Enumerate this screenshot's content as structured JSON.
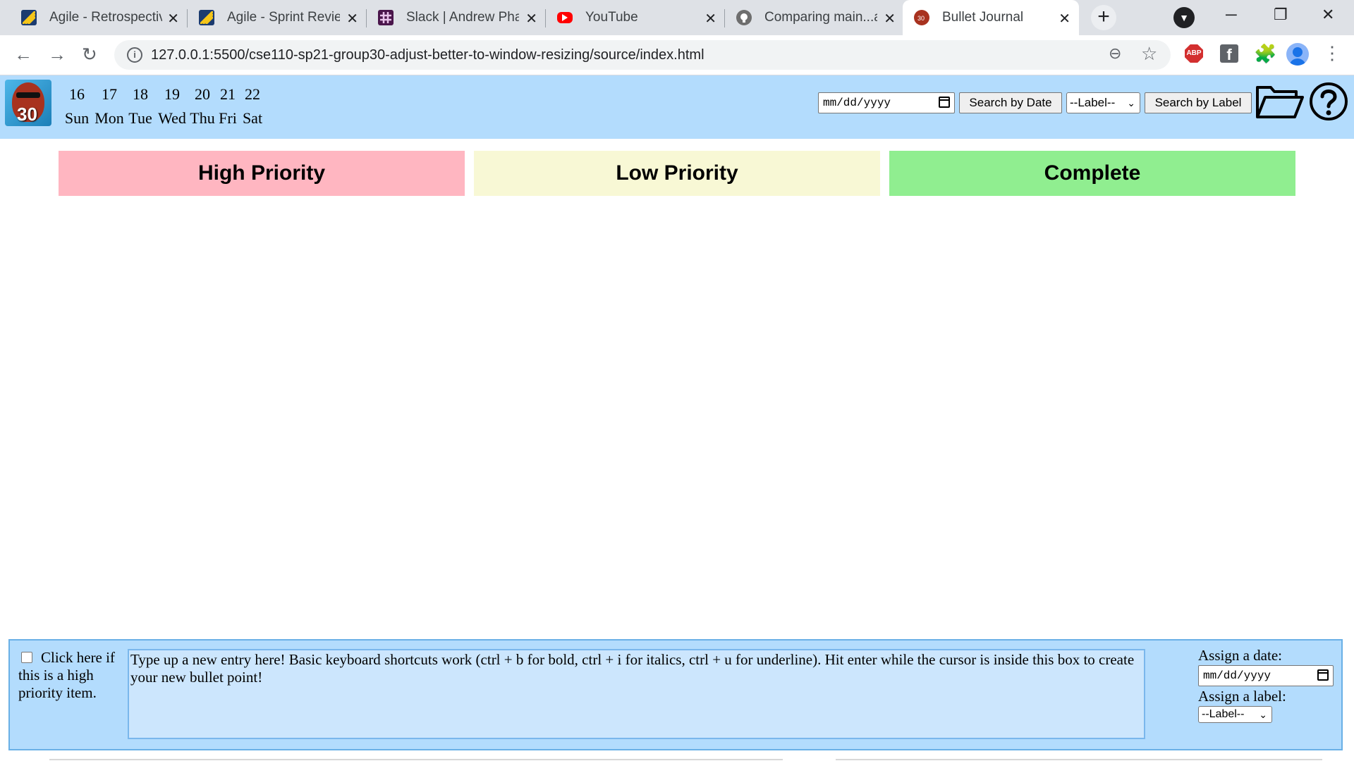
{
  "browser": {
    "tabs": [
      {
        "title": "Agile - Retrospective",
        "icon": "agile-icon",
        "active": false
      },
      {
        "title": "Agile - Sprint Review",
        "icon": "agile-icon",
        "active": false
      },
      {
        "title": "Slack | Andrew Phan",
        "icon": "slack-icon",
        "active": false
      },
      {
        "title": "YouTube",
        "icon": "youtube-icon",
        "active": false
      },
      {
        "title": "Comparing main...a",
        "icon": "github-icon",
        "active": false
      },
      {
        "title": "Bullet Journal",
        "icon": "bullet-journal-icon",
        "active": true
      }
    ],
    "new_tab": "+",
    "url": "127.0.0.1:5500/cse110-sp21-group30-adjust-better-to-window-resizing/source/index.html",
    "extension_abp": "ABP",
    "extension_fb": "f"
  },
  "header": {
    "logo_text": "30",
    "week": [
      {
        "num": "16",
        "name": "Sun"
      },
      {
        "num": "17",
        "name": "Mon"
      },
      {
        "num": "18",
        "name": "Tue"
      },
      {
        "num": "19",
        "name": "Wed"
      },
      {
        "num": "20",
        "name": "Thu"
      },
      {
        "num": "21",
        "name": "Fri"
      },
      {
        "num": "22",
        "name": "Sat"
      }
    ],
    "date_placeholder": "mm/dd/yyyy",
    "search_date_label": "Search by Date",
    "label_select_value": "--Label--",
    "search_label_label": "Search by Label"
  },
  "columns": [
    {
      "title": "High Priority",
      "color": "#ffb6c1"
    },
    {
      "title": "Low Priority",
      "color": "#f8f8d5"
    },
    {
      "title": "Complete",
      "color": "#90ee90"
    }
  ],
  "composer": {
    "priority_checkbox_label": "Click here if this is a high priority item.",
    "entry_text": "Type up a new entry here! Basic keyboard shortcuts work (ctrl + b for bold, ctrl + i for italics, ctrl + u for underline). Hit enter while the cursor is inside this box to create your new bullet point!",
    "assign_date_label": "Assign a date:",
    "date_placeholder": "mm/dd/yyyy",
    "assign_label_label": "Assign a label:",
    "label_select_value": "--Label--"
  },
  "colors": {
    "header_bg": "#b3dcfd",
    "composer_bg": "#b3dcfd",
    "tabbar_bg": "#dee1e6"
  }
}
